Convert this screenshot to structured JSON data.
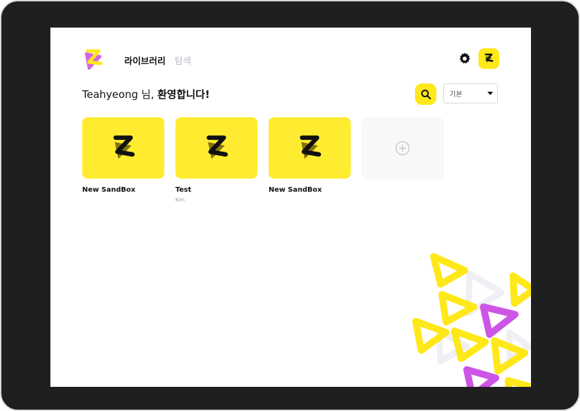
{
  "nav": {
    "library_label": "라이브러리",
    "explore_label": "탐색"
  },
  "welcome": {
    "user_text": "Teahyeong 님, ",
    "greeting_text": "환영합니다!"
  },
  "toolbar": {
    "sort_selected": "기본"
  },
  "sandboxes": [
    {
      "title": "New SandBox",
      "subtitle": ""
    },
    {
      "title": "Test",
      "subtitle": "Kim"
    },
    {
      "title": "New SandBox",
      "subtitle": ""
    }
  ],
  "icons": {
    "logo": "app-logo-icon",
    "settings": "gear-icon",
    "profile": "app-logo-icon",
    "search": "search-icon",
    "add": "plus-circle-icon",
    "sort": "caret-down-icon"
  },
  "colors": {
    "accent_yellow": "#ffe81a",
    "accent_purple": "#cc55e6",
    "text": "#111111",
    "muted": "#b8b8c8"
  }
}
